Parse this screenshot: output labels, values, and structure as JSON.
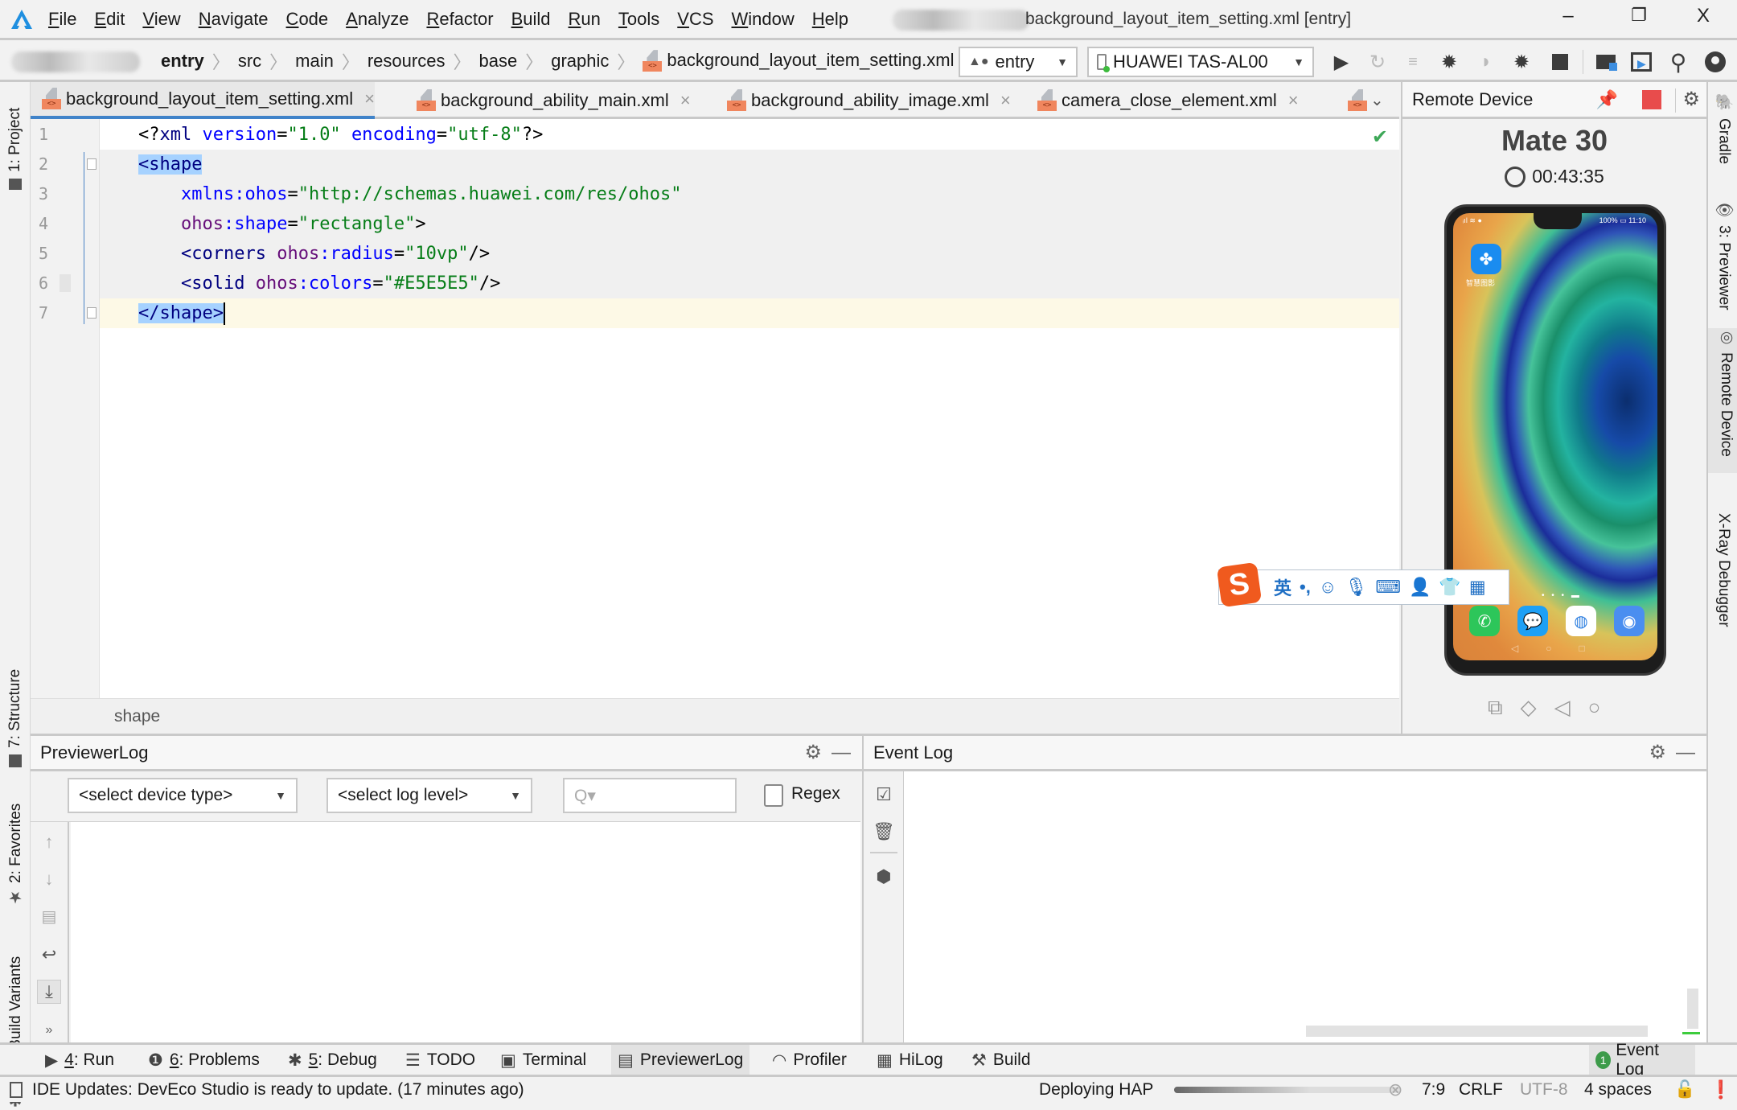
{
  "window": {
    "title": "background_layout_item_setting.xml [entry]",
    "minimize_label": "–",
    "restore_label": "❐",
    "close_label": "X"
  },
  "menu": [
    "File",
    "Edit",
    "View",
    "Navigate",
    "Code",
    "Analyze",
    "Refactor",
    "Build",
    "Run",
    "Tools",
    "VCS",
    "Window",
    "Help"
  ],
  "breadcrumb": [
    "entry",
    "src",
    "main",
    "resources",
    "base",
    "graphic",
    "background_layout_item_setting.xml"
  ],
  "toolbar": {
    "module_config": "entry",
    "device": "HUAWEI TAS-AL00",
    "icons": [
      "run-icon",
      "apply-changes-icon",
      "apply-code-changes-icon",
      "debug-icon",
      "attach-debugger-icon",
      "debug-attach-icon",
      "stop-icon",
      "project-structure-icon",
      "remote-device-icon",
      "search-icon",
      "account-icon"
    ]
  },
  "tabs": [
    {
      "label": "background_layout_item_setting.xml",
      "active": true
    },
    {
      "label": "background_ability_main.xml",
      "active": false
    },
    {
      "label": "background_ability_image.xml",
      "active": false
    },
    {
      "label": "camera_close_element.xml",
      "active": false
    }
  ],
  "file_tag_glyph": "<>",
  "close_glyph": "×",
  "editor": {
    "lines": [
      {
        "n": "1",
        "tokens": [
          {
            "t": "<?",
            "c": "k-pun"
          },
          {
            "t": "xml ",
            "c": "k-tag"
          },
          {
            "t": "version",
            "c": "k-attr"
          },
          {
            "t": "=",
            "c": "k-pun"
          },
          {
            "t": "\"1.0\" ",
            "c": "k-val"
          },
          {
            "t": "encoding",
            "c": "k-attr"
          },
          {
            "t": "=",
            "c": "k-pun"
          },
          {
            "t": "\"utf-8\"",
            "c": "k-val"
          },
          {
            "t": "?>",
            "c": "k-pun"
          }
        ]
      },
      {
        "n": "2",
        "tokens": [
          {
            "t": "<shape",
            "c": "k-tag sel"
          }
        ]
      },
      {
        "n": "3",
        "tokens": [
          {
            "t": "    "
          },
          {
            "t": "xmlns",
            "c": "k-attr"
          },
          {
            "t": ":ohos",
            "c": "k-attr"
          },
          {
            "t": "=",
            "c": "k-pun"
          },
          {
            "t": "\"http://schemas.huawei.com/res/ohos\"",
            "c": "k-val"
          }
        ]
      },
      {
        "n": "4",
        "tokens": [
          {
            "t": "    "
          },
          {
            "t": "ohos",
            "c": "k-ns"
          },
          {
            "t": ":shape",
            "c": "k-attr"
          },
          {
            "t": "=",
            "c": "k-pun"
          },
          {
            "t": "\"rectangle\"",
            "c": "k-val"
          },
          {
            "t": ">",
            "c": "k-pun"
          }
        ]
      },
      {
        "n": "5",
        "tokens": [
          {
            "t": "    "
          },
          {
            "t": "<corners ",
            "c": "k-tag"
          },
          {
            "t": "ohos",
            "c": "k-ns"
          },
          {
            "t": ":radius",
            "c": "k-attr"
          },
          {
            "t": "=",
            "c": "k-pun"
          },
          {
            "t": "\"10vp\"",
            "c": "k-val"
          },
          {
            "t": "/>",
            "c": "k-pun"
          }
        ]
      },
      {
        "n": "6",
        "tokens": [
          {
            "t": "    "
          },
          {
            "t": "<solid ",
            "c": "k-tag"
          },
          {
            "t": "ohos",
            "c": "k-ns"
          },
          {
            "t": ":colors",
            "c": "k-attr"
          },
          {
            "t": "=",
            "c": "k-pun"
          },
          {
            "t": "\"#E5E5E5\"",
            "c": "k-val"
          },
          {
            "t": "/>",
            "c": "k-pun"
          }
        ]
      },
      {
        "n": "7",
        "tokens": [
          {
            "t": "</shape>",
            "c": "k-tag sel"
          }
        ]
      }
    ],
    "caret_line": 7,
    "caret_col": 9,
    "inspection_status": "✔"
  },
  "editor_breadcrumb": "shape",
  "left_strip": [
    "1: Project",
    "7: Structure",
    "2: Favorites",
    "OhosBuild Variants"
  ],
  "right_strip": [
    "Gradle",
    "3: Previewer",
    "Remote Device",
    "X-Ray Debugger"
  ],
  "remote_device": {
    "title": "Remote Device",
    "device_name": "Mate 30",
    "timer": "00:43:35",
    "phone_status": {
      "battery": "100%",
      "time": "11:10"
    },
    "home_app_label": "智慧图影"
  },
  "ime": {
    "lang": "英",
    "punct": "•,"
  },
  "previewer_log": {
    "title": "PreviewerLog",
    "device_type": "<select device type>",
    "log_level": "<select log level>",
    "search_placeholder": "Q▾",
    "regex_label": "Regex",
    "regex_checked": false
  },
  "event_log": {
    "title": "Event Log"
  },
  "tool_windows": [
    {
      "key": "4",
      "label": ": Run",
      "icon": "▶"
    },
    {
      "key": "6",
      "label": ": Problems",
      "icon": "❶"
    },
    {
      "key": "5",
      "label": ": Debug",
      "icon": "✱"
    },
    {
      "key": "",
      "label": "TODO",
      "icon": "☰"
    },
    {
      "key": "",
      "label": "Terminal",
      "icon": "▣"
    },
    {
      "key": "",
      "label": "PreviewerLog",
      "icon": "▤"
    },
    {
      "key": "",
      "label": "Profiler",
      "icon": "◠"
    },
    {
      "key": "",
      "label": "HiLog",
      "icon": "▦"
    },
    {
      "key": "",
      "label": "Build",
      "icon": "⚒"
    }
  ],
  "event_log_button": {
    "badge": "1",
    "label": "Event Log"
  },
  "status": {
    "message": "IDE Updates: DevEco Studio is ready to update. (17 minutes ago)",
    "progress_label": "Deploying HAP",
    "progress": 0.6,
    "position": "7:9",
    "line_sep": "CRLF",
    "encoding": "UTF-8",
    "indent": "4 spaces"
  }
}
